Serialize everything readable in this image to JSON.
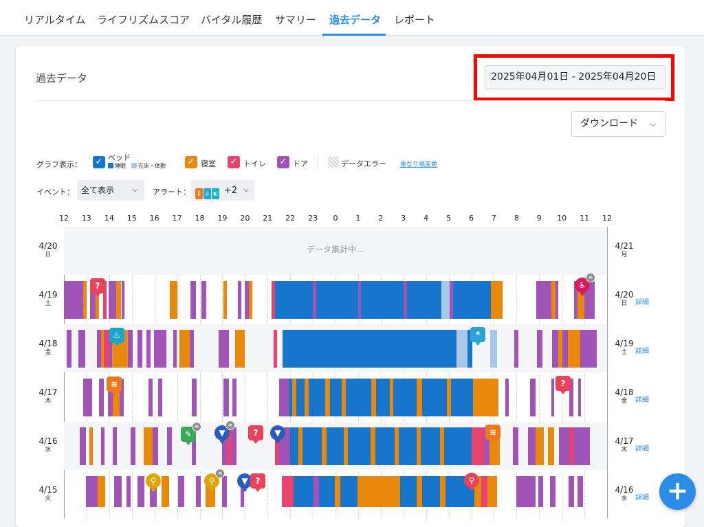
{
  "tabs": [
    "リアルタイム",
    "ライフリズムスコア",
    "バイタル履歴",
    "サマリー",
    "過去データ",
    "レポート"
  ],
  "active_tab": "過去データ",
  "page_title": "過去データ",
  "date_range": "2025年04月01日 - 2025年04月20日",
  "download_label": "ダウンロード",
  "legend": {
    "graph_label": "グラフ表示：",
    "bed": "ベッド",
    "bed_sleep": "睡眠",
    "bed_in": "在床・体動",
    "bedroom": "寝室",
    "toilet": "トイレ",
    "door": "ドア",
    "data_error": "データエラー",
    "order_link": "重なり順変更"
  },
  "filters": {
    "event_label": "イベント：",
    "event_value": "全て表示",
    "alert_label": "アラート：",
    "alert_more": "+2"
  },
  "colors": {
    "bed_sleep": "#1775cc",
    "bed_in": "#a9c8e8",
    "bedroom": "#e8890c",
    "toilet": "#e8436f",
    "door": "#a154b8",
    "accent": "#2d8ce6"
  },
  "icons": {
    "alert_icons": [
      "thermometer-icon",
      "droplet-icon",
      "drop-icon"
    ],
    "markers": [
      "sos-person-icon",
      "fall-icon",
      "water-icon",
      "cold-icon",
      "heat-icon",
      "toilet-icon",
      "flashlight-icon",
      "shower-icon"
    ],
    "fab": "plus-icon"
  },
  "axis_hours": [
    "12",
    "13",
    "14",
    "15",
    "16",
    "17",
    "18",
    "19",
    "20",
    "21",
    "22",
    "23",
    "0",
    "1",
    "2",
    "3",
    "4",
    "5",
    "6",
    "7",
    "8",
    "9",
    "10",
    "11",
    "12"
  ],
  "rows": [
    {
      "date": "4/20",
      "wday": "日",
      "next_date": "4/21",
      "next_wday": "月",
      "status": "データ集計中...",
      "detail": ""
    },
    {
      "date": "4/19",
      "wday": "土",
      "next_date": "4/20",
      "next_wday": "日",
      "status": "",
      "detail": "詳細"
    },
    {
      "date": "4/18",
      "wday": "金",
      "next_date": "4/19",
      "next_wday": "土",
      "status": "",
      "detail": "詳細"
    },
    {
      "date": "4/17",
      "wday": "木",
      "next_date": "4/18",
      "next_wday": "金",
      "status": "",
      "detail": "詳細"
    },
    {
      "date": "4/16",
      "wday": "水",
      "next_date": "4/17",
      "next_wday": "木",
      "status": "",
      "detail": "詳細"
    },
    {
      "date": "4/15",
      "wday": "火",
      "next_date": "4/16",
      "next_wday": "水",
      "status": "",
      "detail": "詳細"
    }
  ],
  "fab_label": "+"
}
